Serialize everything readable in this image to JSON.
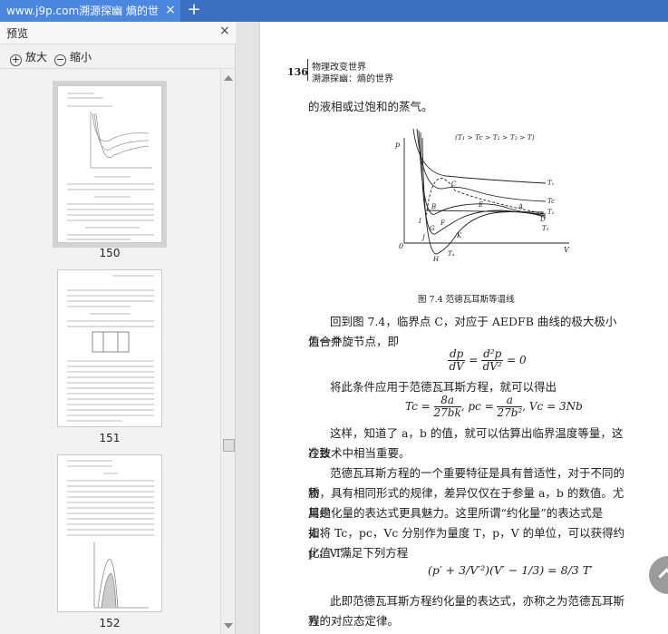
{
  "tab": {
    "title": "www.j9p.com溯源探幽  熵的世",
    "close": "×",
    "new": "+"
  },
  "sidebar": {
    "title": "预览",
    "close": "×",
    "zoom_in": "放大",
    "zoom_out": "缩小",
    "pages": [
      "150",
      "151",
      "152"
    ]
  },
  "doc": {
    "page_no": "136",
    "running_head_1": "物理改变世界",
    "running_head_2": "溯源探幽：熵的世界",
    "line_top": "的液相或过饱和的蒸气。",
    "fig_caption": "图 7.4   范德瓦耳斯等温线",
    "fig_condition": "(T₁ > Tc > T₂ > T₃ > T)",
    "fig_axis_p": "p",
    "fig_axis_v": "V",
    "fig_origin": "0",
    "fig_labels": [
      "C",
      "B",
      "E",
      "A",
      "D",
      "F",
      "I",
      "J",
      "K",
      "G",
      "H",
      "T₁",
      "Tc",
      "T₂",
      "T₃",
      "T₄"
    ],
    "p1_l1": "回到图 7.4，临界点 C，对应于 AEDFB 曲线的极大极小值合并",
    "p1_l2": "为一个旋节点，即",
    "eq1": {
      "n1": "dp",
      "d1": "dV",
      "n2": "d²p",
      "d2": "dV²",
      "rhs": "= 0"
    },
    "p2": "将此条件应用于范德瓦耳斯方程，就可以得出",
    "eq2": {
      "tc": "Tc =",
      "tcn": "8a",
      "tcd": "27bk",
      "pc": "pc =",
      "pcn": "a",
      "pcd": "27b²",
      "vc": "Vc = 3Nb"
    },
    "p3_l1": "这样，知道了 a，b 的值，就可以估算出临界温度等量，这在致",
    "p3_l2": "冷技术中相当重要。",
    "p4_l1": "范德瓦耳斯方程的一个重要特征是具有普适性，对于不同的物",
    "p4_l2": "质，具有相同形式的规律，差异仅仅在于参量 a，b 的数值。尤其是",
    "p4_l3": "用约化量的表达式更具魅力。这里所谓“约化量”的表达式是指：",
    "p4_l4": "如将 Tc，pc，Vc 分别作为量度 T，p，V 的单位，可以获得约化值 T′，",
    "p4_l5": "p′，V′满足下列方程",
    "eq3": "(p′ + 3/V′²)(V′ − 1/3) = 8/3 T′",
    "p5_l1": "此即范德瓦耳斯方程约化量的表达式，亦称之为范德瓦耳斯方",
    "p5_l2": "程的对应态定律。"
  }
}
